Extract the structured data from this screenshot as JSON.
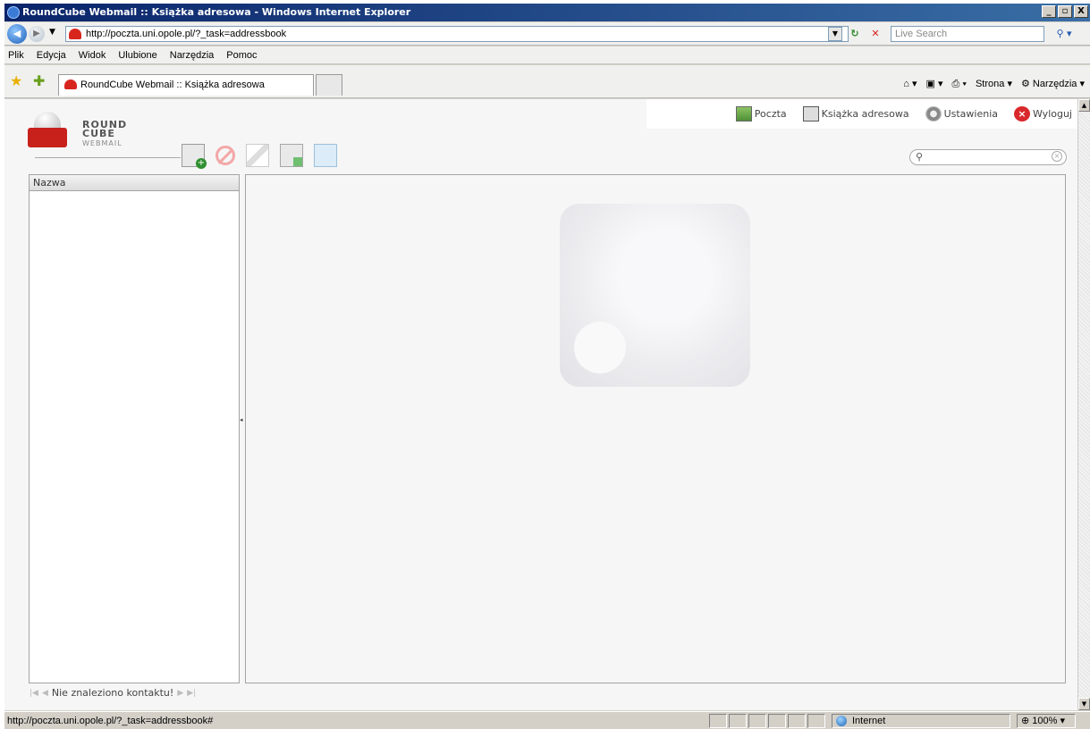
{
  "window": {
    "title": "RoundCube Webmail :: Książka adresowa - Windows Internet Explorer",
    "minimize": "_",
    "maximize": "▫",
    "close": "X"
  },
  "address_bar": {
    "url": "http://poczta.uni.opole.pl/?_task=addressbook",
    "search_placeholder": "Live Search"
  },
  "menu": [
    "Plik",
    "Edycja",
    "Widok",
    "Ulubione",
    "Narzędzia",
    "Pomoc"
  ],
  "tab": {
    "label": "RoundCube Webmail :: Książka adresowa"
  },
  "command_bar": {
    "page": "Strona",
    "tools": "Narzędzia"
  },
  "app": {
    "logo": {
      "line1": "ROUND",
      "line2": "CUBE",
      "line3": "WEBMAIL"
    },
    "nav": [
      {
        "label": "Poczta",
        "icon": "mail-icon"
      },
      {
        "label": "Książka adresowa",
        "icon": "addressbook-icon"
      },
      {
        "label": "Ustawienia",
        "icon": "gear-icon"
      },
      {
        "label": "Wyloguj",
        "icon": "logout-icon"
      }
    ],
    "toolbar": [
      "add-contact-icon",
      "delete-icon",
      "edit-icon",
      "compose-to-contacts-icon",
      "export-icon"
    ],
    "search": {
      "value": ""
    },
    "list": {
      "header": "Nazwa"
    },
    "footer": {
      "message": "Nie znaleziono kontaktu!"
    }
  },
  "status_bar": {
    "text": "http://poczta.uni.opole.pl/?_task=addressbook#",
    "zone": "Internet",
    "zoom": "100%"
  }
}
